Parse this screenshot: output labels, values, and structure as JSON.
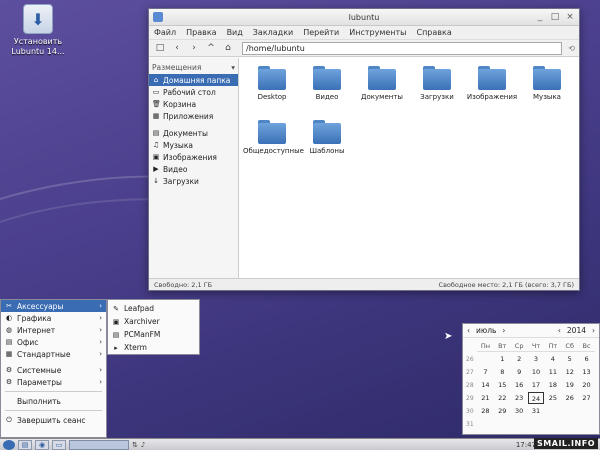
{
  "desktop": {
    "icon_label": "Установить Lubuntu 14..."
  },
  "window": {
    "title": "lubuntu",
    "menu": [
      "Файл",
      "Правка",
      "Вид",
      "Закладки",
      "Перейти",
      "Инструменты",
      "Справка"
    ],
    "path": "/home/lubuntu",
    "sidebar_header": "Размещения",
    "sidebar_items": [
      {
        "label": "Домашняя папка",
        "icon": "home-icon",
        "active": true
      },
      {
        "label": "Рабочий стол",
        "icon": "desktop-icon"
      },
      {
        "label": "Корзина",
        "icon": "trash-icon"
      },
      {
        "label": "Приложения",
        "icon": "apps-icon"
      },
      {
        "label": "Документы",
        "icon": "documents-icon"
      },
      {
        "label": "Музыка",
        "icon": "music-icon"
      },
      {
        "label": "Изображения",
        "icon": "pictures-icon"
      },
      {
        "label": "Видео",
        "icon": "video-icon"
      },
      {
        "label": "Загрузки",
        "icon": "downloads-icon"
      }
    ],
    "folders": [
      "Desktop",
      "Видео",
      "Документы",
      "Загрузки",
      "Изображения",
      "Музыка",
      "Общедоступные",
      "Шаблоны"
    ],
    "status_left": "Свободно: 2,1 ГБ",
    "status_right": "Свободное место: 2,1 ГБ (всего: 3,7 ГБ)"
  },
  "start_menu": {
    "items": [
      {
        "label": "Аксессуары",
        "icon": "accessories-icon",
        "arrow": true,
        "active": true
      },
      {
        "label": "Графика",
        "icon": "graphics-icon",
        "arrow": true
      },
      {
        "label": "Интернет",
        "icon": "internet-icon",
        "arrow": true
      },
      {
        "label": "Офис",
        "icon": "office-icon",
        "arrow": true
      },
      {
        "label": "Стандартные",
        "icon": "standard-icon",
        "arrow": true
      }
    ],
    "items2": [
      {
        "label": "Системные",
        "icon": "system-icon",
        "arrow": true
      },
      {
        "label": "Параметры",
        "icon": "settings-icon",
        "arrow": true
      }
    ],
    "run": "Выполнить",
    "logout": "Завершить сеанс",
    "submenu": [
      {
        "label": "Leafpad",
        "icon": "leafpad-icon"
      },
      {
        "label": "Xarchiver",
        "icon": "archive-icon"
      },
      {
        "label": "PCManFM",
        "icon": "filemanager-icon"
      },
      {
        "label": "Xterm",
        "icon": "terminal-icon"
      }
    ]
  },
  "calendar": {
    "month": "июль",
    "year": "2014",
    "day_headers": [
      "Пн",
      "Вт",
      "Ср",
      "Чт",
      "Пт",
      "Сб",
      "Вс"
    ],
    "weeks": [
      "26",
      "27",
      "28",
      "29",
      "30",
      "31"
    ],
    "days": [
      "",
      "1",
      "2",
      "3",
      "4",
      "5",
      "6",
      "7",
      "8",
      "9",
      "10",
      "11",
      "12",
      "13",
      "14",
      "15",
      "16",
      "17",
      "18",
      "19",
      "20",
      "21",
      "22",
      "23",
      "24",
      "25",
      "26",
      "27",
      "28",
      "29",
      "30",
      "31",
      "",
      "",
      ""
    ],
    "today": "24"
  },
  "taskbar": {
    "clock": "17:47",
    "watermark": "SMAIL.INFO"
  },
  "colors": {
    "accent": "#3a6cb4",
    "desktop_bg": "#4a3f8c",
    "folder": "#4f86c6"
  }
}
